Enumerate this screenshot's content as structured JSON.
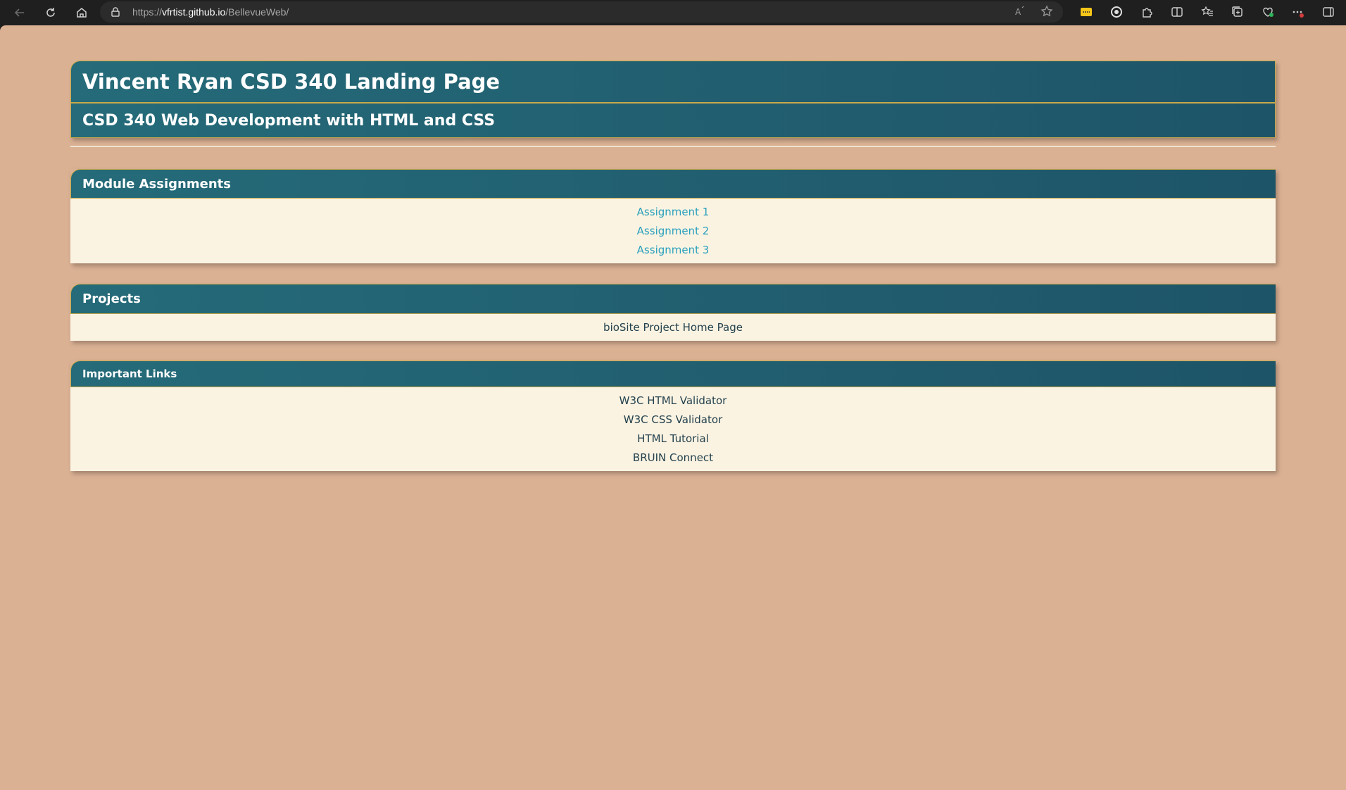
{
  "browser": {
    "url_scheme": "https://",
    "url_host": "vfrtist.github.io",
    "url_path": "/BellevueWeb/"
  },
  "page": {
    "title": "Vincent Ryan CSD 340 Landing Page",
    "subtitle": "CSD 340 Web Development with HTML and CSS"
  },
  "modules": {
    "heading": "Module Assignments",
    "links": [
      "Assignment 1",
      "Assignment 2",
      "Assignment 3"
    ]
  },
  "projects": {
    "heading": "Projects",
    "links": [
      "bioSite Project Home Page"
    ]
  },
  "important": {
    "heading": "Important Links",
    "links": [
      "W3C HTML Validator",
      "W3C CSS Validator",
      "HTML Tutorial",
      "BRUIN Connect"
    ]
  },
  "colors": {
    "page_bg": "#dbb194",
    "header_bg": "#256b79",
    "border_gold": "#c9a94a",
    "panel_bg": "#fbf3e2",
    "link_teal": "#2aa0bd",
    "link_dark": "#23414d"
  },
  "icons": [
    "back-icon",
    "refresh-icon",
    "home-icon",
    "lock-icon",
    "read-aloud-icon",
    "favorite-star-icon",
    "extension-yellow-icon",
    "extension-circle-icon",
    "extensions-puzzle-icon",
    "split-screen-icon",
    "favorites-icon",
    "collections-icon",
    "browser-essentials-icon",
    "more-menu-icon",
    "sidebar-icon"
  ]
}
